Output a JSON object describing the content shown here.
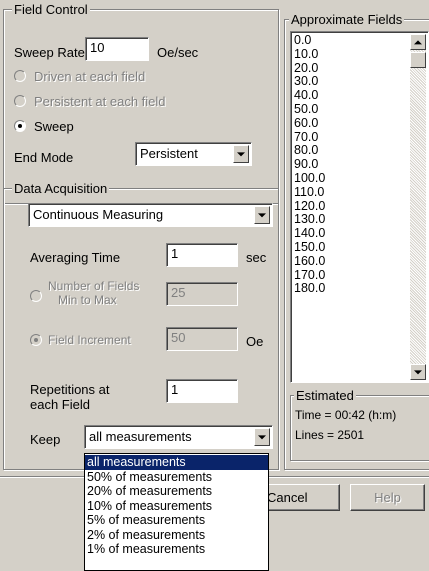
{
  "field_control": {
    "legend": "Field Control",
    "sweep_rate_label": "Sweep Rate",
    "sweep_rate_value": "10",
    "sweep_rate_unit": "Oe/sec",
    "mode_options": [
      {
        "label": "Driven at each field",
        "selected": false,
        "enabled": false
      },
      {
        "label": "Persistent at each field",
        "selected": false,
        "enabled": false
      },
      {
        "label": "Sweep",
        "selected": true,
        "enabled": true
      }
    ],
    "end_mode_label": "End Mode",
    "end_mode_value": "Persistent"
  },
  "data_acquisition": {
    "legend": "Data Acquisition",
    "mode_value": "Continuous Measuring",
    "averaging_time_label": "Averaging Time",
    "averaging_time_value": "1",
    "averaging_time_unit": "sec",
    "num_fields_label_line1": "Number of Fields",
    "num_fields_label_line2": "Min to Max",
    "num_fields_value": "25",
    "field_increment_label": "Field Increment",
    "field_increment_value": "50",
    "field_increment_unit": "Oe",
    "repetitions_label_line1": "Repetitions at",
    "repetitions_label_line2": "each Field",
    "repetitions_value": "1",
    "keep_label": "Keep",
    "keep_value": "all measurements",
    "keep_options": [
      "all measurements",
      "50% of measurements",
      "20% of measurements",
      "10% of measurements",
      "5% of measurements",
      "2% of measurements",
      "1% of measurements"
    ],
    "keep_selected_index": 0
  },
  "approximate_fields": {
    "legend": "Approximate Fields",
    "values": [
      "0.0",
      "10.0",
      "20.0",
      "30.0",
      "40.0",
      "50.0",
      "60.0",
      "70.0",
      "80.0",
      "90.0",
      "100.0",
      "110.0",
      "120.0",
      "130.0",
      "140.0",
      "150.0",
      "160.0",
      "170.0",
      "180.0"
    ]
  },
  "estimated": {
    "legend": "Estimated",
    "time_text": "Time = 00:42 (h:m)",
    "lines_text": "Lines = 2501"
  },
  "buttons": {
    "cancel": "Cancel",
    "help": "Help"
  }
}
